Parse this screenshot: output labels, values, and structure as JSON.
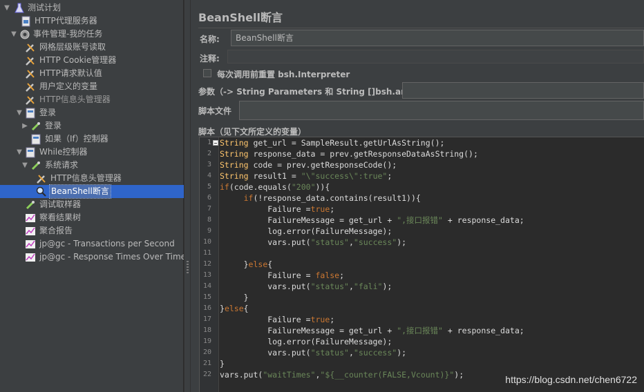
{
  "tree": {
    "items": [
      {
        "label": "测试计划",
        "icon": "flask-icon"
      },
      {
        "label": "HTTP代理服务器",
        "icon": "proxy-icon"
      },
      {
        "label": "事件管理-我的任务",
        "icon": "gear-icon"
      },
      {
        "label": "网格层级账号读取",
        "icon": "wrench-icon"
      },
      {
        "label": "HTTP Cookie管理器",
        "icon": "wrench-icon"
      },
      {
        "label": "HTTP请求默认值",
        "icon": "wrench-icon"
      },
      {
        "label": "用户定义的变量",
        "icon": "wrench-icon"
      },
      {
        "label": "HTTP信息头管理器",
        "icon": "wrench-icon"
      },
      {
        "label": "登录",
        "icon": "controller-icon"
      },
      {
        "label": "登录",
        "icon": "pipette-icon"
      },
      {
        "label": "如果（If）控制器",
        "icon": "controller-icon"
      },
      {
        "label": "While控制器",
        "icon": "controller-icon"
      },
      {
        "label": "系统请求",
        "icon": "pipette-icon"
      },
      {
        "label": "HTTP信息头管理器",
        "icon": "wrench-icon"
      },
      {
        "label": "BeanShell断言",
        "icon": "magnifier-icon"
      },
      {
        "label": "调试取样器",
        "icon": "pipette-icon"
      },
      {
        "label": "察看结果树",
        "icon": "graph-icon"
      },
      {
        "label": "聚合报告",
        "icon": "graph-icon"
      },
      {
        "label": "jp@gc - Transactions per Second",
        "icon": "graph-icon"
      },
      {
        "label": "jp@gc - Response Times Over Time",
        "icon": "graph-icon"
      }
    ],
    "selected_index": 14
  },
  "panel": {
    "title": "BeanShell断言",
    "name_label": "名称:",
    "name_value": "BeanShell断言",
    "comment_label": "注释:",
    "comment_value": "",
    "reset_label": "每次调用前重置 bsh.Interpreter",
    "reset_checked": false,
    "params_label": "参数（-> String Parameters 和 String []bsh.args）",
    "params_value": "",
    "script_file_label": "脚本文件",
    "script_file_value": "",
    "script_label": "脚本（见下文所定义的变量）"
  },
  "code": {
    "line_numbers": [
      "1",
      "2",
      "3",
      "4",
      "5",
      "6",
      "7",
      "8",
      "9",
      "10",
      "11",
      "12",
      "13",
      "14",
      "15",
      "16",
      "17",
      "18",
      "19",
      "20",
      "21",
      "22"
    ],
    "lines": [
      "String get_url = SampleResult.getUrlAsString();",
      "String response_data = prev.getResponseDataAsString();",
      "String code = prev.getResponseCode();",
      "String result1 = \"\\\"success\\\":true\";",
      "if(code.equals(\"200\")){",
      "     if(!response_data.contains(result1)){",
      "          Failure =true;",
      "          FailureMessage = get_url + \",接口报错\" + response_data;",
      "          log.error(FailureMessage);",
      "          vars.put(\"status\",\"success\");",
      "",
      "     }else{",
      "          Failure = false;",
      "          vars.put(\"status\",\"fali\");",
      "     }",
      "}else{",
      "          Failure =true;",
      "          FailureMessage = get_url + \",接口报错\" + response_data;",
      "          log.error(FailureMessage);",
      "          vars.put(\"status\",\"success\");",
      "}",
      "vars.put(\"waitTimes\",\"${__counter(FALSE,Vcount)}\");"
    ]
  },
  "watermark": "https://blog.csdn.net/chen6722",
  "colors": {
    "background": "#3c3f41",
    "selection": "#2f65ca",
    "editor_bg": "#2b2b2b"
  }
}
